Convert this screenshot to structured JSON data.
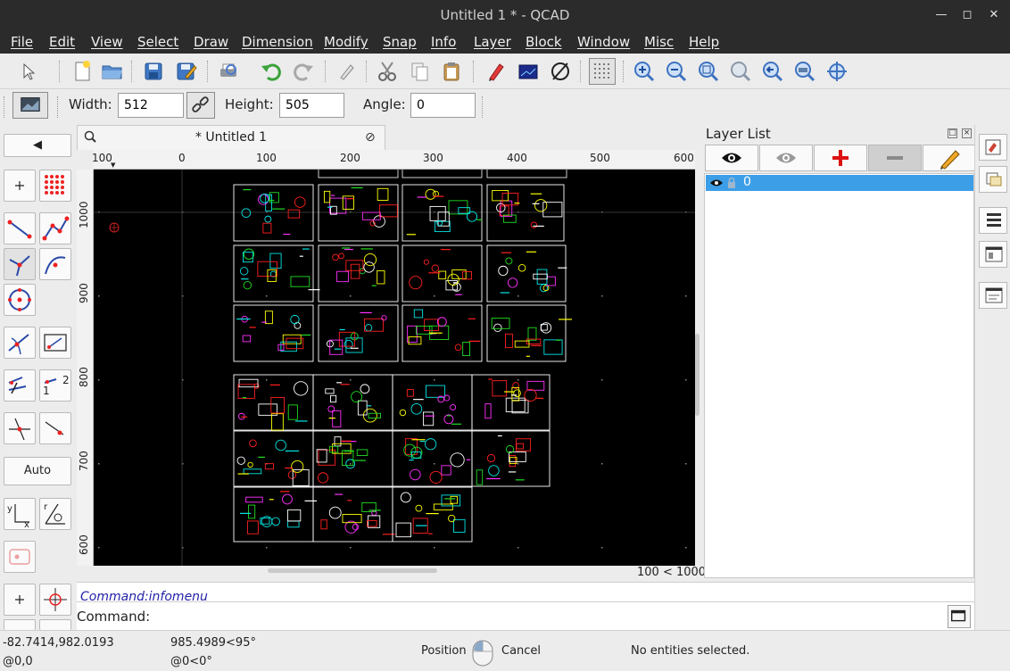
{
  "window": {
    "title": "Untitled 1 * - QCAD"
  },
  "menu": [
    "File",
    "Edit",
    "View",
    "Select",
    "Draw",
    "Dimension",
    "Modify",
    "Snap",
    "Info",
    "Layer",
    "Block",
    "Window",
    "Misc",
    "Help"
  ],
  "options": {
    "width_label": "Width:",
    "width_value": "512",
    "height_label": "Height:",
    "height_value": "505",
    "angle_label": "Angle:",
    "angle_value": "0"
  },
  "palette": {
    "auto_label": "Auto",
    "counter_one": "1",
    "counter_two": "2"
  },
  "document": {
    "tab_title": "* Untitled 1"
  },
  "rulers": {
    "x_ticks": [
      "100",
      "0",
      "100",
      "200",
      "300",
      "400",
      "500",
      "600"
    ],
    "y_ticks": [
      "1000",
      "900",
      "800",
      "700",
      "600"
    ]
  },
  "canvas": {
    "grid_size_readout": "100 < 1000"
  },
  "command": {
    "history": "Command:infomenu",
    "label": "Command:",
    "value": ""
  },
  "layers": {
    "title": "Layer List",
    "items": [
      {
        "name": "0",
        "visible": true,
        "locked": false,
        "selected": true
      }
    ]
  },
  "status": {
    "abs_coords": "-82.7414,982.0193",
    "rel_coords": "@0,0",
    "polar_coords": "985.4989<95°",
    "rel_polar": "@0<0°",
    "mouse_left": "Position",
    "mouse_right": "Cancel",
    "selection": "No entities selected."
  },
  "colors": {
    "chrome_dark": "#2b2b2b",
    "canvas_bg": "#000000",
    "selection_blue": "#3d9ee8",
    "cad_red": "#ff2020",
    "cad_yellow": "#ffff00",
    "cad_green": "#22dd22",
    "cad_cyan": "#00e5e5",
    "cad_magenta": "#ff30ff"
  },
  "icons": {
    "toolbar": [
      "pointer-icon",
      "new-document-icon",
      "open-folder-icon",
      "save-icon",
      "save-as-icon",
      "print-preview-icon",
      "undo-icon",
      "redo-icon",
      "clear-icon",
      "cut-icon",
      "copy-icon",
      "paste-icon",
      "pen-icon",
      "display-icon",
      "restrict-icon",
      "grid-icon",
      "zoom-in-icon",
      "zoom-out-icon",
      "zoom-auto-icon",
      "zoom-window-icon",
      "zoom-previous-icon",
      "zoom-selection-icon",
      "pan-icon"
    ]
  }
}
